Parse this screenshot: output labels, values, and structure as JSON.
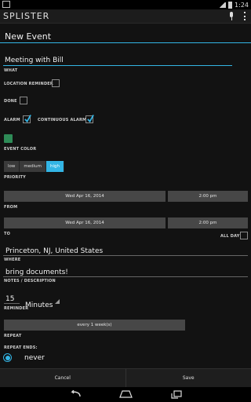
{
  "status_bar": {
    "time": "1:24"
  },
  "action_bar": {
    "app_title": "SPLISTER"
  },
  "page": {
    "title": "New Event"
  },
  "what": {
    "value": "Meeting with Bill",
    "caption": "WHAT"
  },
  "location_reminder": {
    "label": "LOCATION REMINDER",
    "checked": false
  },
  "done": {
    "label": "DONE",
    "checked": false
  },
  "alarm": {
    "label": "ALARM",
    "checked": true
  },
  "continuous_alarm": {
    "label": "CONTINUOUS ALARM",
    "checked": true
  },
  "event_color": {
    "label": "EVENT COLOR",
    "color": "#2e8b57"
  },
  "priority": {
    "label": "PRIORITY",
    "options": [
      "low",
      "medium",
      "high"
    ],
    "selected": "high"
  },
  "from": {
    "date": "Wed Apr 16, 2014",
    "time": "2:00 pm",
    "caption": "FROM"
  },
  "to": {
    "date": "Wed Apr 16, 2014",
    "time": "2:00 pm",
    "caption": "TO",
    "all_day_label": "ALL DAY"
  },
  "where": {
    "value": "Princeton, NJ, United States",
    "caption": "WHERE"
  },
  "notes": {
    "value": "bring documents!",
    "caption": "NOTES / DESCRIPTION"
  },
  "reminder": {
    "amount": "15",
    "unit": "Minutes",
    "caption": "REMINDER"
  },
  "repeat": {
    "button": "every 1 week(s)",
    "caption": "REPEAT"
  },
  "repeat_ends": {
    "label": "REPEAT ENDS:",
    "option": "never"
  },
  "buttons": {
    "cancel": "Cancel",
    "save": "Save"
  },
  "colors": {
    "accent": "#33b5e5",
    "background": "#121212"
  }
}
